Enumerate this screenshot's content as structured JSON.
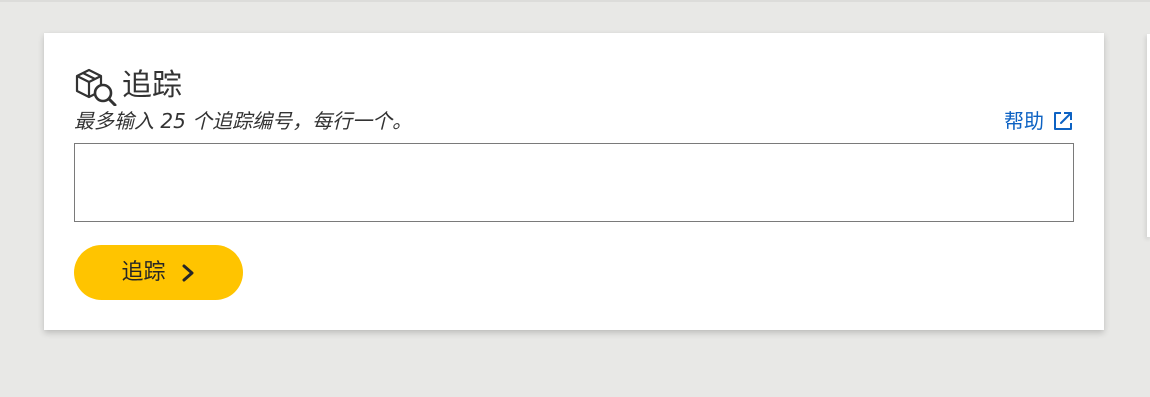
{
  "track": {
    "title": "追踪",
    "instruction": "最多输入 25 个追踪编号，每行一个。",
    "help_label": "帮助",
    "input_value": "",
    "button_label": "追踪",
    "icons": {
      "package": "package-search-icon",
      "help": "external-link-icon",
      "button": "chevron-right-icon"
    },
    "colors": {
      "page_background": "#e8e8e6",
      "card_background": "#ffffff",
      "link": "#0d62c3",
      "button": "#ffc400",
      "text": "#333333"
    }
  }
}
